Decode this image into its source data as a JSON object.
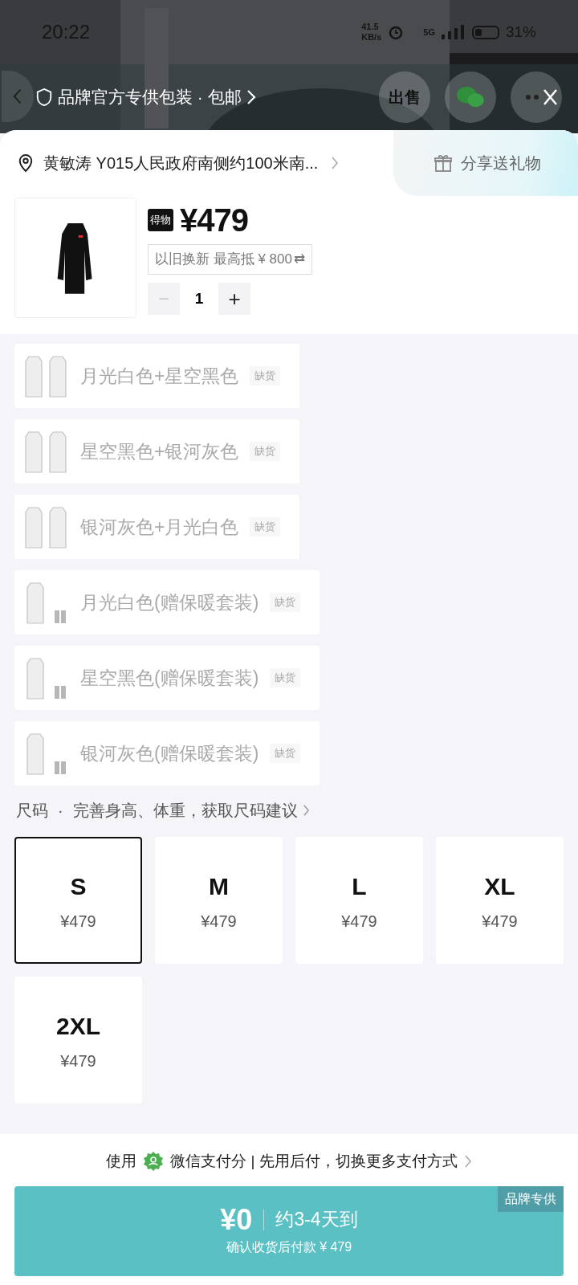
{
  "status_bar": {
    "time": "20:22",
    "speed": "41.5",
    "speed_unit": "KB/s",
    "network": "5G",
    "battery": "31%"
  },
  "header": {
    "brand_tag": "品牌官方专供包装 · 包邮",
    "sell_button": "出售"
  },
  "address": {
    "text": "黄敏涛 Y015人民政府南侧约100米南...",
    "gift": "分享送礼物"
  },
  "product": {
    "badge": "得物",
    "price": "¥479",
    "trade_in": "以旧换新 最高抵 ¥ 800",
    "trade_in_icon": "⇄",
    "quantity": "1",
    "minus": "−",
    "plus": "+",
    "minus_disabled": true
  },
  "variants": [
    {
      "label": "月光白色+星空黑色",
      "tag": "缺货",
      "disabled": true,
      "kind": "pair"
    },
    {
      "label": "星空黑色+银河灰色",
      "tag": "缺货",
      "disabled": true,
      "kind": "pair"
    },
    {
      "label": "银河灰色+月光白色",
      "tag": "缺货",
      "disabled": true,
      "kind": "pair"
    },
    {
      "label": "月光白色(赠保暖套装)",
      "tag": "缺货",
      "disabled": true,
      "kind": "set"
    },
    {
      "label": "星空黑色(赠保暖套装)",
      "tag": "缺货",
      "disabled": true,
      "kind": "set"
    },
    {
      "label": "银河灰色(赠保暖套装)",
      "tag": "缺货",
      "disabled": true,
      "kind": "set"
    }
  ],
  "size_section": {
    "title": "尺码",
    "separator": "·",
    "hint": "完善身高、体重，获取尺码建议"
  },
  "sizes": [
    {
      "size": "S",
      "price": "¥479",
      "selected": true
    },
    {
      "size": "M",
      "price": "¥479",
      "selected": false
    },
    {
      "size": "L",
      "price": "¥479",
      "selected": false
    },
    {
      "size": "XL",
      "price": "¥479",
      "selected": false
    },
    {
      "size": "2XL",
      "price": "¥479",
      "selected": false
    }
  ],
  "payment": {
    "prefix": "使用",
    "text": "微信支付分 | 先用后付，切换更多支付方式"
  },
  "buy_button": {
    "price": "¥0",
    "delivery": "约3-4天到",
    "note": "确认收货后付款 ¥ 479",
    "tag": "品牌专供"
  }
}
